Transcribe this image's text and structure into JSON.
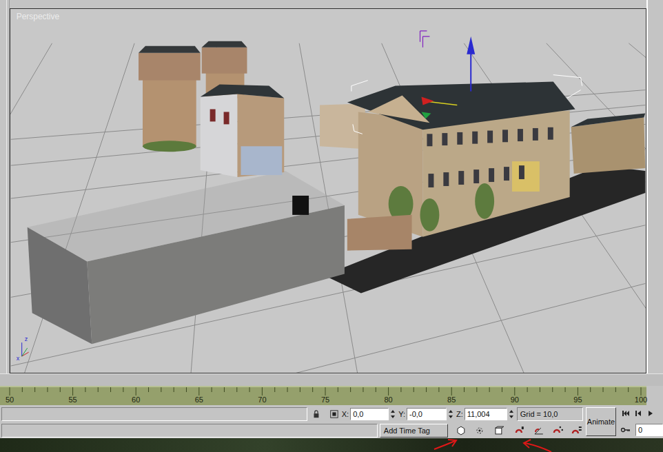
{
  "viewport": {
    "label": "Perspective",
    "axes": [
      "z",
      "x"
    ]
  },
  "timeline": {
    "ticks": [
      "50",
      "55",
      "60",
      "65",
      "70",
      "75",
      "80",
      "85",
      "90",
      "95",
      "100"
    ]
  },
  "status_bar": {
    "coords": [
      {
        "axis": "X:",
        "value": "0,0"
      },
      {
        "axis": "Y:",
        "value": "-0,0"
      },
      {
        "axis": "Z:",
        "value": "11,004"
      }
    ],
    "grid": "Grid = 10,0",
    "add_time_tag": "Add Time Tag",
    "animate": "Animate",
    "frame": "0"
  }
}
